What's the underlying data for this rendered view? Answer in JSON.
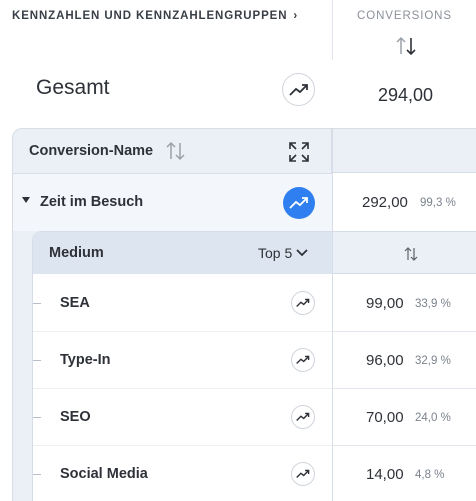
{
  "header": {
    "breadcrumb": "KENNZAHLEN UND KENNZAHLENGRUPPEN",
    "breadcrumb_chevron": "›",
    "column_title": "CONVERSIONS"
  },
  "total": {
    "label": "Gesamt",
    "value": "294,00"
  },
  "table": {
    "column_header": "Conversion-Name",
    "group": {
      "label": "Zeit im Besuch",
      "value": "292,00",
      "percent": "99,3 %"
    },
    "subtable": {
      "header": "Medium",
      "top_selector": "Top 5",
      "rows": [
        {
          "label": "SEA",
          "value": "99,00",
          "percent": "33,9 %"
        },
        {
          "label": "Type-In",
          "value": "96,00",
          "percent": "32,9 %"
        },
        {
          "label": "SEO",
          "value": "70,00",
          "percent": "24,0 %"
        },
        {
          "label": "Social Media",
          "value": "14,00",
          "percent": "4,8 %"
        }
      ]
    }
  },
  "icons": [
    "sort-icon",
    "trend-icon",
    "expand-icon",
    "chevron-down-icon"
  ],
  "colors": {
    "accent": "#2f7ff0",
    "panel_bg": "#eaf0f6",
    "subheader_bg": "#dde6f0"
  }
}
